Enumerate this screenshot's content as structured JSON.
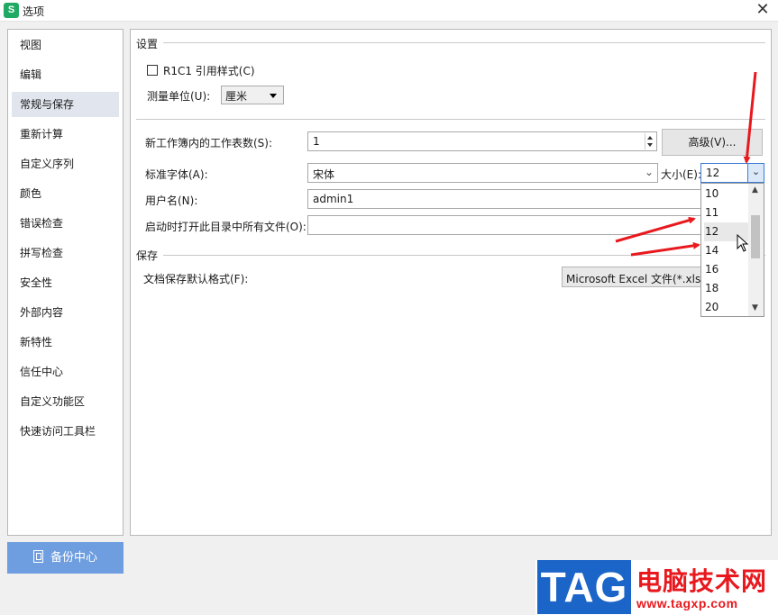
{
  "window": {
    "app_icon": "S",
    "title": "选项",
    "close": "✕"
  },
  "sidebar": {
    "items": [
      {
        "label": "视图",
        "active": false
      },
      {
        "label": "编辑",
        "active": false
      },
      {
        "label": "常规与保存",
        "active": true
      },
      {
        "label": "重新计算",
        "active": false
      },
      {
        "label": "自定义序列",
        "active": false
      },
      {
        "label": "颜色",
        "active": false
      },
      {
        "label": "错误检查",
        "active": false
      },
      {
        "label": "拼写检查",
        "active": false
      },
      {
        "label": "安全性",
        "active": false
      },
      {
        "label": "外部内容",
        "active": false
      },
      {
        "label": "新特性",
        "active": false
      },
      {
        "label": "信任中心",
        "active": false
      },
      {
        "label": "自定义功能区",
        "active": false
      },
      {
        "label": "快速访问工具栏",
        "active": false
      }
    ]
  },
  "backup_button": {
    "label": "备份中心",
    "icon": "backup-icon"
  },
  "settings": {
    "section_title": "设置",
    "r1c1_label": "R1C1 引用样式(C)",
    "r1c1_checked": false,
    "unit_label": "测量单位(U):",
    "unit_value": "厘米",
    "sheet_count_label": "新工作簿内的工作表数(S):",
    "sheet_count_value": "1",
    "advanced_button": "高级(V)...",
    "font_label": "标准字体(A):",
    "font_value": "宋体",
    "size_label": "大小(E):",
    "size_value": "12",
    "size_options": [
      "10",
      "11",
      "12",
      "14",
      "16",
      "18",
      "20"
    ],
    "size_selected": "12",
    "username_label": "用户名(N):",
    "username_value": "admin1",
    "startup_label": "启动时打开此目录中所有文件(O):",
    "startup_value": ""
  },
  "save": {
    "section_title": "保存",
    "format_label": "文档保存默认格式(F):",
    "format_value": "Microsoft Excel 文件(*.xlsx"
  },
  "watermark": {
    "tag": "TAG",
    "site_name": "电脑技术网",
    "url": "www.tagxp.com"
  },
  "colors": {
    "accent": "#6f9ee0",
    "arrow": "#e8191e",
    "active_nav": "#e1e6ee"
  }
}
